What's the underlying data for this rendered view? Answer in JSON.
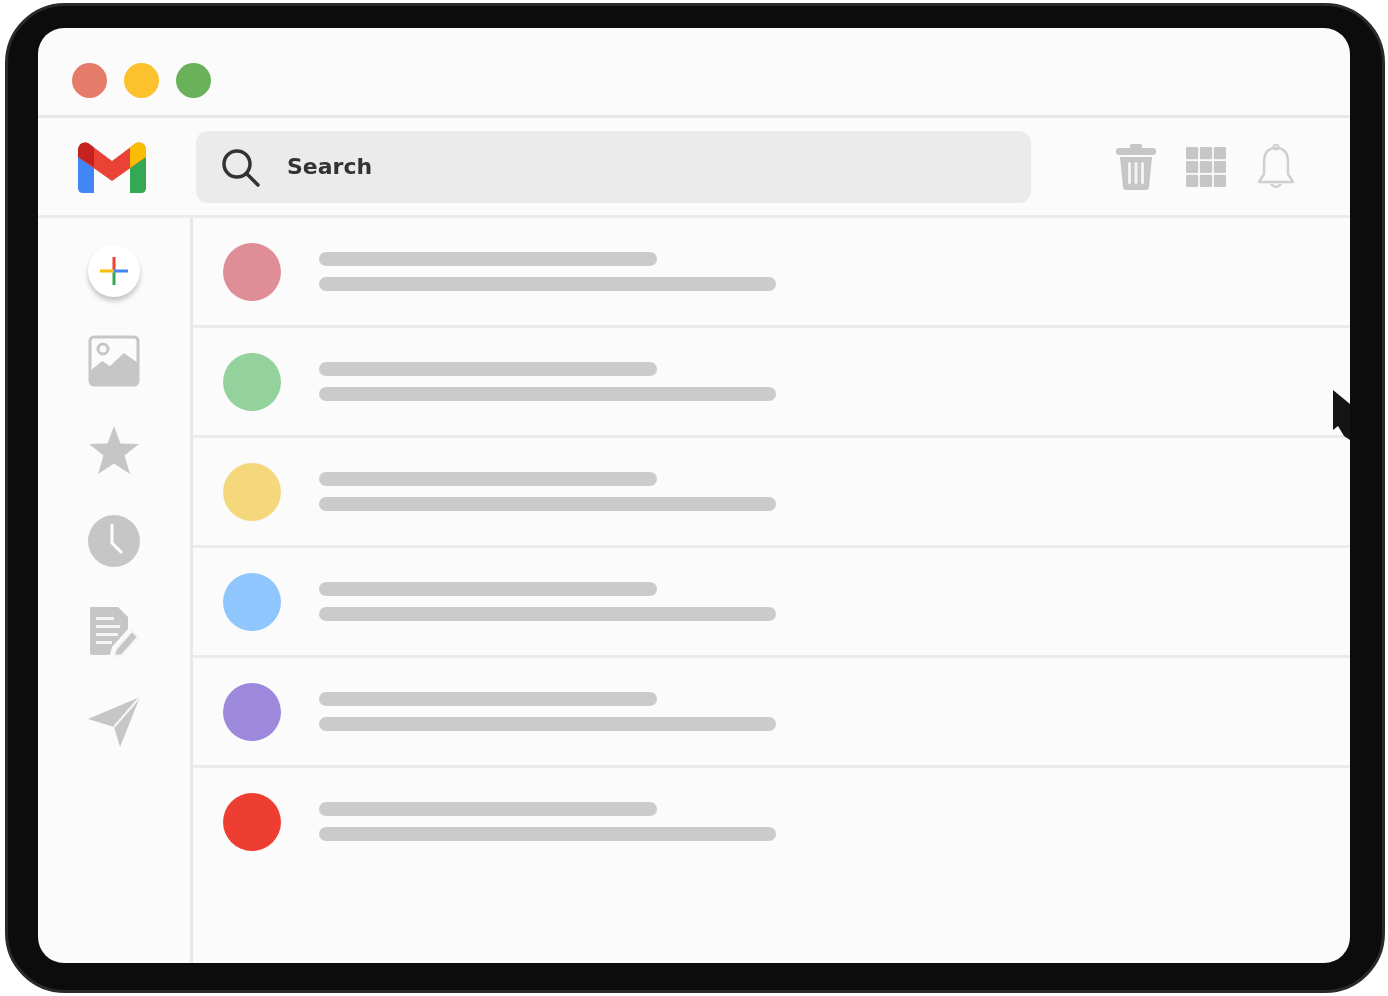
{
  "window": {
    "controls": [
      {
        "color": "#e47c69"
      },
      {
        "color": "#fcc22d"
      },
      {
        "color": "#6ab25a"
      }
    ]
  },
  "search": {
    "placeholder": "Search"
  },
  "messages": [
    {
      "color": "#df8e98"
    },
    {
      "color": "#93d29c"
    },
    {
      "color": "#f6d87c"
    },
    {
      "color": "#8ec6fd"
    },
    {
      "color": "#9c89dc"
    },
    {
      "color": "#ee3e32"
    }
  ]
}
